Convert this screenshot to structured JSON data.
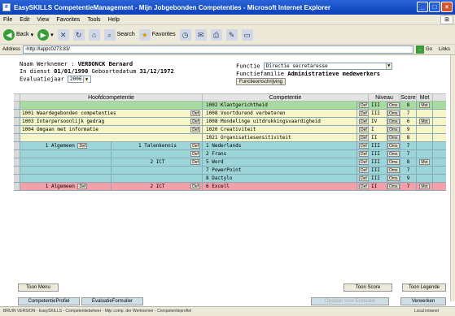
{
  "window": {
    "title": "EasySKILLS CompetentieManagement - Mijn Jobgebonden Competenties - Microsoft Internet Explorer"
  },
  "menu": [
    "File",
    "Edit",
    "View",
    "Favorites",
    "Tools",
    "Help"
  ],
  "toolbar": {
    "back": "Back",
    "search": "Search",
    "favorites": "Favorites"
  },
  "address": {
    "label": "Address",
    "url": "http://lappc0273:83/",
    "go": "Go",
    "links": "Links"
  },
  "employee": {
    "name_label": "Naam Werknemer",
    "name": "VERDONCK Bernard",
    "indienst_label": "In dienst",
    "indienst": "01/01/1990",
    "geboorte_label": "Geboortedatum",
    "geboorte": "31/12/1972",
    "evaluatiejaar_label": "Evaluatiejaar",
    "evaluatiejaar": "2006",
    "functie_label": "Functie",
    "functie": "Directie secretaresse",
    "familie_label": "Functiefamilie",
    "familie": "Administratieve medewerkers",
    "functieomschrijving": "Functieomschrijving"
  },
  "grid": {
    "headers": {
      "hoofd": "Hoofdcompetentie",
      "comp": "Competentie",
      "niveau": "Niveau",
      "score": "Score",
      "mot": "Mot"
    },
    "def": "Def",
    "oms": "Oms",
    "motbtn": "Mot",
    "rows": [
      {
        "color": "green",
        "hoofd": "",
        "hoofdDef": false,
        "comp": "1002 Klantgerichtheid",
        "niveau": "III",
        "score": "8",
        "mot": true
      },
      {
        "color": "yellow",
        "hoofd": "1001 Waardegebonden competenties",
        "hoofdDef": true,
        "comp": "1008 Voortdurend verbeteren",
        "niveau": "III",
        "score": "7",
        "mot": false
      },
      {
        "color": "yellow",
        "hoofd": "1003 Interpersoonlijk gedrag",
        "hoofdDef": true,
        "comp": "1008 Mondelinge uitdrukkingsvaardigheid",
        "niveau": "IV",
        "score": "6",
        "mot": true
      },
      {
        "color": "yellow",
        "hoofd": "1004 Omgaan met informatie",
        "hoofdDef": true,
        "comp": "1020 Creativiteit",
        "niveau": "I",
        "score": "9",
        "mot": false
      },
      {
        "color": "yellow",
        "hoofd": "",
        "hoofdDef": false,
        "comp": "1021 Organisatiesensitiviteit",
        "niveau": "II",
        "score": "8",
        "mot": false
      },
      {
        "color": "cyan",
        "split": true,
        "h1": "1 Algemeen",
        "h1Def": true,
        "h2": "1 Talenkennis",
        "h2Def": true,
        "comp": "1 Nederlands",
        "niveau": "III",
        "score": "7",
        "mot": false
      },
      {
        "color": "cyan",
        "split": true,
        "h1": "",
        "h1Def": false,
        "h2": "",
        "h2Def": true,
        "comp": "2 Frans",
        "niveau": "III",
        "score": "7",
        "mot": false
      },
      {
        "color": "cyan",
        "split": true,
        "h1": "",
        "h1Def": false,
        "h2": "2 ICT",
        "h2Def": true,
        "comp": "5 Word",
        "niveau": "III",
        "score": "8",
        "mot": true
      },
      {
        "color": "cyan",
        "split": true,
        "h1": "",
        "h1Def": false,
        "h2": "",
        "h2Def": false,
        "comp": "7 PowerPoint",
        "niveau": "III",
        "score": "7",
        "mot": false
      },
      {
        "color": "cyan",
        "split": true,
        "h1": "",
        "h1Def": false,
        "h2": "",
        "h2Def": false,
        "comp": "8 Dactylo",
        "niveau": "III",
        "score": "9",
        "mot": false
      },
      {
        "color": "pink",
        "split": true,
        "h1": "1 Algemeen",
        "h1Def": true,
        "h2": "2 ICT",
        "h2Def": true,
        "comp": "6 Excell",
        "niveau": "II",
        "score": "7",
        "mot": true
      }
    ]
  },
  "buttons": {
    "toon_menu": "Toon Menu",
    "toon_score": "Toon Score",
    "toon_legende": "Toon Legende",
    "competentieprofiel": "CompetentieProfiel",
    "evaluatieformulier": "EvaluatieFormulier",
    "opslaan": "Opslaan voor Evaluatie",
    "verwerken": "Verwerken"
  },
  "status": {
    "text": "BRUIN VERSION - EasySKILLS - Competentiebeheer - Mijn comp. der Werknemer - Competentieprofiel",
    "zone": "Local intranet"
  }
}
